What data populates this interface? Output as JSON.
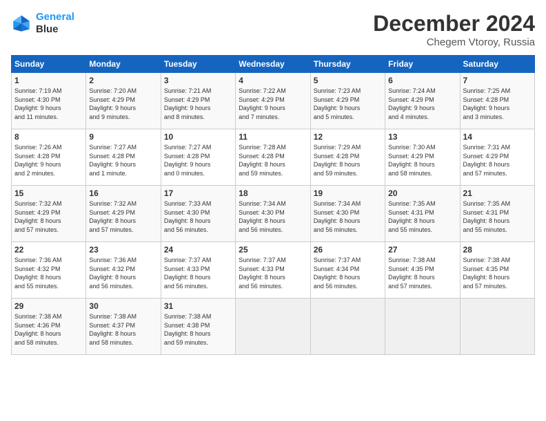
{
  "header": {
    "logo_line1": "General",
    "logo_line2": "Blue",
    "main_title": "December 2024",
    "subtitle": "Chegem Vtoroy, Russia"
  },
  "days_of_week": [
    "Sunday",
    "Monday",
    "Tuesday",
    "Wednesday",
    "Thursday",
    "Friday",
    "Saturday"
  ],
  "weeks": [
    [
      {
        "day": "1",
        "info": "Sunrise: 7:19 AM\nSunset: 4:30 PM\nDaylight: 9 hours\nand 11 minutes."
      },
      {
        "day": "2",
        "info": "Sunrise: 7:20 AM\nSunset: 4:29 PM\nDaylight: 9 hours\nand 9 minutes."
      },
      {
        "day": "3",
        "info": "Sunrise: 7:21 AM\nSunset: 4:29 PM\nDaylight: 9 hours\nand 8 minutes."
      },
      {
        "day": "4",
        "info": "Sunrise: 7:22 AM\nSunset: 4:29 PM\nDaylight: 9 hours\nand 7 minutes."
      },
      {
        "day": "5",
        "info": "Sunrise: 7:23 AM\nSunset: 4:29 PM\nDaylight: 9 hours\nand 5 minutes."
      },
      {
        "day": "6",
        "info": "Sunrise: 7:24 AM\nSunset: 4:29 PM\nDaylight: 9 hours\nand 4 minutes."
      },
      {
        "day": "7",
        "info": "Sunrise: 7:25 AM\nSunset: 4:28 PM\nDaylight: 9 hours\nand 3 minutes."
      }
    ],
    [
      {
        "day": "8",
        "info": "Sunrise: 7:26 AM\nSunset: 4:28 PM\nDaylight: 9 hours\nand 2 minutes."
      },
      {
        "day": "9",
        "info": "Sunrise: 7:27 AM\nSunset: 4:28 PM\nDaylight: 9 hours\nand 1 minute."
      },
      {
        "day": "10",
        "info": "Sunrise: 7:27 AM\nSunset: 4:28 PM\nDaylight: 9 hours\nand 0 minutes."
      },
      {
        "day": "11",
        "info": "Sunrise: 7:28 AM\nSunset: 4:28 PM\nDaylight: 8 hours\nand 59 minutes."
      },
      {
        "day": "12",
        "info": "Sunrise: 7:29 AM\nSunset: 4:28 PM\nDaylight: 8 hours\nand 59 minutes."
      },
      {
        "day": "13",
        "info": "Sunrise: 7:30 AM\nSunset: 4:29 PM\nDaylight: 8 hours\nand 58 minutes."
      },
      {
        "day": "14",
        "info": "Sunrise: 7:31 AM\nSunset: 4:29 PM\nDaylight: 8 hours\nand 57 minutes."
      }
    ],
    [
      {
        "day": "15",
        "info": "Sunrise: 7:32 AM\nSunset: 4:29 PM\nDaylight: 8 hours\nand 57 minutes."
      },
      {
        "day": "16",
        "info": "Sunrise: 7:32 AM\nSunset: 4:29 PM\nDaylight: 8 hours\nand 57 minutes."
      },
      {
        "day": "17",
        "info": "Sunrise: 7:33 AM\nSunset: 4:30 PM\nDaylight: 8 hours\nand 56 minutes."
      },
      {
        "day": "18",
        "info": "Sunrise: 7:34 AM\nSunset: 4:30 PM\nDaylight: 8 hours\nand 56 minutes."
      },
      {
        "day": "19",
        "info": "Sunrise: 7:34 AM\nSunset: 4:30 PM\nDaylight: 8 hours\nand 56 minutes."
      },
      {
        "day": "20",
        "info": "Sunrise: 7:35 AM\nSunset: 4:31 PM\nDaylight: 8 hours\nand 55 minutes."
      },
      {
        "day": "21",
        "info": "Sunrise: 7:35 AM\nSunset: 4:31 PM\nDaylight: 8 hours\nand 55 minutes."
      }
    ],
    [
      {
        "day": "22",
        "info": "Sunrise: 7:36 AM\nSunset: 4:32 PM\nDaylight: 8 hours\nand 55 minutes."
      },
      {
        "day": "23",
        "info": "Sunrise: 7:36 AM\nSunset: 4:32 PM\nDaylight: 8 hours\nand 56 minutes."
      },
      {
        "day": "24",
        "info": "Sunrise: 7:37 AM\nSunset: 4:33 PM\nDaylight: 8 hours\nand 56 minutes."
      },
      {
        "day": "25",
        "info": "Sunrise: 7:37 AM\nSunset: 4:33 PM\nDaylight: 8 hours\nand 56 minutes."
      },
      {
        "day": "26",
        "info": "Sunrise: 7:37 AM\nSunset: 4:34 PM\nDaylight: 8 hours\nand 56 minutes."
      },
      {
        "day": "27",
        "info": "Sunrise: 7:38 AM\nSunset: 4:35 PM\nDaylight: 8 hours\nand 57 minutes."
      },
      {
        "day": "28",
        "info": "Sunrise: 7:38 AM\nSunset: 4:35 PM\nDaylight: 8 hours\nand 57 minutes."
      }
    ],
    [
      {
        "day": "29",
        "info": "Sunrise: 7:38 AM\nSunset: 4:36 PM\nDaylight: 8 hours\nand 58 minutes."
      },
      {
        "day": "30",
        "info": "Sunrise: 7:38 AM\nSunset: 4:37 PM\nDaylight: 8 hours\nand 58 minutes."
      },
      {
        "day": "31",
        "info": "Sunrise: 7:38 AM\nSunset: 4:38 PM\nDaylight: 8 hours\nand 59 minutes."
      },
      null,
      null,
      null,
      null
    ]
  ]
}
